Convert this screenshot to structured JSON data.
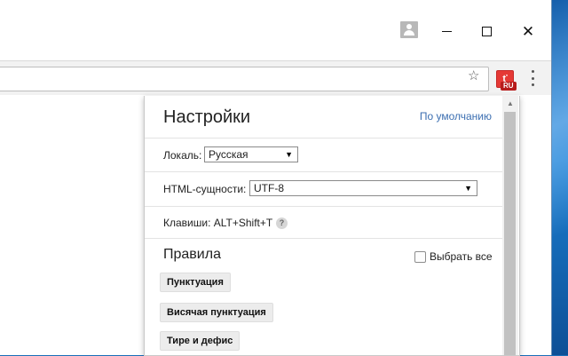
{
  "window": {
    "controls": {
      "profile_icon": "avatar-icon",
      "minimize_icon": "minimize-icon",
      "maximize_icon": "maximize-icon",
      "close_icon": "close-icon",
      "close_glyph": "✕"
    }
  },
  "toolbar": {
    "star_glyph": "☆",
    "extension": {
      "glyph": "ť",
      "badge": "RU"
    }
  },
  "popup": {
    "title": "Настройки",
    "reset_link": "По умолчанию",
    "locale": {
      "label": "Локаль:",
      "value": "Русская"
    },
    "html_entities": {
      "label": "HTML-сущности:",
      "value": "UTF-8"
    },
    "hotkeys": {
      "label": "Клавиши: ALT+Shift+T",
      "help": "?"
    },
    "rules": {
      "title": "Правила",
      "select_all": "Выбрать все",
      "items": [
        {
          "label": "Пунктуация"
        },
        {
          "label": "Висячая пунктуация"
        },
        {
          "label": "Тире и дефис"
        }
      ]
    }
  },
  "colors": {
    "accent_link": "#3c6fb1",
    "extension_red": "#e53935"
  }
}
